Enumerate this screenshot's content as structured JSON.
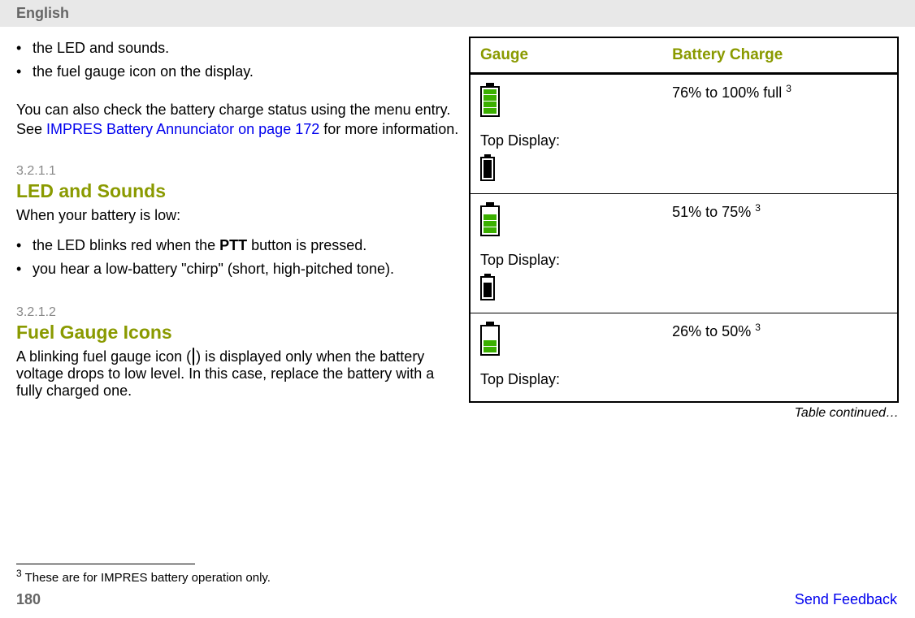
{
  "header": "English",
  "left": {
    "bullets_top": [
      "the LED and sounds.",
      "the fuel gauge icon on the display."
    ],
    "para_before_link": "You can also check the battery charge status using the menu entry. See ",
    "link": "IMPRES Battery Annunciator on page 172",
    "para_after_link": " for more information.",
    "section1_num": "3.2.1.1",
    "section1_title": "LED and Sounds",
    "section1_intro": "When your battery is low:",
    "section1_bullets": [
      {
        "pre": "the LED blinks red when the ",
        "bold": "PTT",
        "post": " button is pressed."
      },
      {
        "pre": "you hear a low-battery \"chirp\" (short, high-pitched tone).",
        "bold": "",
        "post": ""
      }
    ],
    "section2_num": "3.2.1.2",
    "section2_title": "Fuel Gauge Icons",
    "section2_para_before": "A blinking fuel gauge icon (",
    "section2_para_after": ") is displayed only when the battery voltage drops to low level. In this case, replace the battery with a fully charged one."
  },
  "table": {
    "th_gauge": "Gauge",
    "th_charge": "Battery Charge",
    "top_display_label": "Top Display:",
    "rows": [
      {
        "charge": "76% to 100% full ",
        "sup": "3",
        "bars": 4,
        "black_fill_h": 22
      },
      {
        "charge": "51% to 75% ",
        "sup": "3",
        "bars": 3,
        "black_fill_h": 18
      },
      {
        "charge": "26% to 50% ",
        "sup": "3",
        "bars": 2,
        "black_fill_h": 0
      }
    ],
    "continued": "Table continued…"
  },
  "footnote_sup": "3",
  "footnote_text": "  These are for IMPRES battery operation only.",
  "page_number": "180",
  "feedback": "Send Feedback"
}
